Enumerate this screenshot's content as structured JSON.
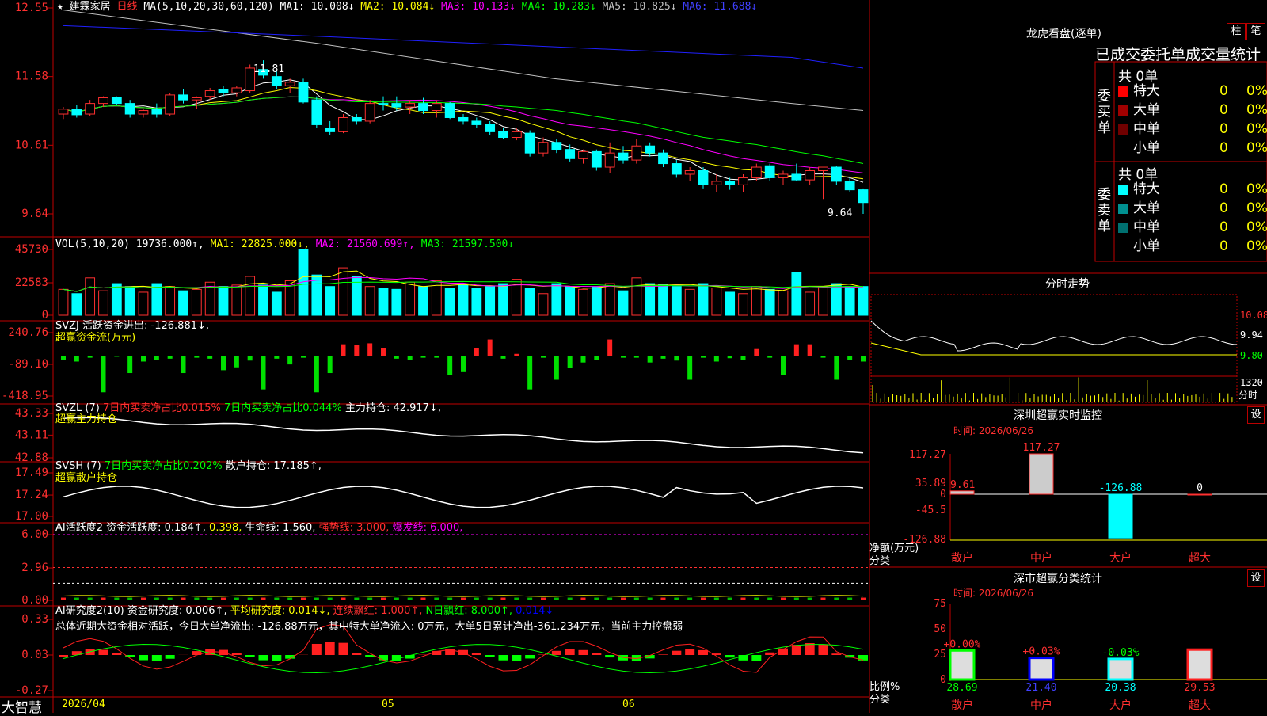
{
  "stock": {
    "name": "建霖家居",
    "period": "日线",
    "star": "★"
  },
  "ma_legend": {
    "prefix": "MA(5,10,20,30,60,120)",
    "items": [
      {
        "label": "MA1: 10.008↓",
        "color": "#ffffff"
      },
      {
        "label": "MA2: 10.084↓",
        "color": "#ffff00"
      },
      {
        "label": "MA3: 10.133↓",
        "color": "#ff00ff"
      },
      {
        "label": "MA4: 10.283↓",
        "color": "#00ff00"
      },
      {
        "label": "MA5: 10.825↓",
        "color": "#c0c0c0"
      },
      {
        "label": "MA6: 11.688↓",
        "color": "#0000ff"
      }
    ]
  },
  "price_axis": [
    "12.55",
    "11.58",
    "10.61",
    "9.64"
  ],
  "price_marks": {
    "high": "11.81",
    "low": "9.64"
  },
  "vol_legend": {
    "prefix": "VOL(5,10,20)",
    "value": "19736.000↑,",
    "items": [
      {
        "label": "MA1: 22825.000↓,",
        "color": "#ffff00"
      },
      {
        "label": "MA2: 21560.699↑,",
        "color": "#ff00ff"
      },
      {
        "label": "MA3: 21597.500↓",
        "color": "#00ff00"
      }
    ]
  },
  "vol_axis": [
    "45730",
    "22583",
    "0"
  ],
  "svzj": {
    "l1": "SVZJ",
    "l2": "活跃资金进出: -126.881↓,",
    "l3": "超赢资金流(万元)",
    "axis": [
      "240.76",
      "-89.10",
      "-418.95"
    ]
  },
  "svzl": {
    "l1": "SVZL (7)",
    "l2": "7日内买卖净占比0.015%",
    "l3": "7日内买卖净占比0.044%",
    "l4": "主力持仓: 42.917↓,",
    "l5": "超赢主力持仓",
    "axis": [
      "43.33",
      "43.11",
      "42.88"
    ]
  },
  "svsh": {
    "l1": "SVSH (7)",
    "l2": "7日内买卖净占比0.202%",
    "l3": "散户持仓: 17.185↑,",
    "l4": "超赢散户持仓",
    "axis": [
      "17.49",
      "17.24",
      "17.00"
    ]
  },
  "ai1": {
    "l1": "AI活跃度2",
    "l2": "资金活跃度: 0.184↑,",
    "l3": "0.398,",
    "l4": "生命线: 1.560,",
    "l5": "强势线: 3.000,",
    "l6": "爆发线: 6.000,",
    "axis": [
      "6.00",
      "2.96",
      "0.00"
    ]
  },
  "ai2": {
    "l1": "AI研究度2(10)",
    "l2": "资金研究度: 0.006↑,",
    "l3": "平均研究度: 0.014↓,",
    "l4": "连续飘红: 1.000↑,",
    "l5": "N日飘红: 8.000↑,",
    "l6": "0.014↓",
    "summary": "总体近期大资金相对活跃，今日大单净流出: -126.88万元，其中特大单净流入: 0万元，大单5日累计净出-361.234万元，当前主力控盘弱",
    "axis": [
      "0.33",
      "0.03",
      "-0.27"
    ]
  },
  "xaxis": {
    "d1": "2026/04",
    "d2": "05",
    "d3": "06",
    "brand": "大智慧"
  },
  "right": {
    "longhu_title": "龙虎看盘(逐单)",
    "btn_zhu": "柱",
    "btn_bi": "笔",
    "stats_header": "已成交委托单成交量统计",
    "buy": {
      "label": "委买单",
      "total": "共 0单",
      "rows": [
        {
          "name": "特大",
          "n": "0",
          "p": "0%",
          "color": "#ff0000"
        },
        {
          "name": "大单",
          "n": "0",
          "p": "0%",
          "color": "#a00000"
        },
        {
          "name": "中单",
          "n": "0",
          "p": "0%",
          "color": "#700000"
        },
        {
          "name": "小单",
          "n": "0",
          "p": "0%",
          "color": "#000000"
        }
      ]
    },
    "sell": {
      "label": "委卖单",
      "total": "共 0单",
      "rows": [
        {
          "name": "特大",
          "n": "0",
          "p": "0%",
          "color": "#00ffff"
        },
        {
          "name": "大单",
          "n": "0",
          "p": "0%",
          "color": "#009090"
        },
        {
          "name": "中单",
          "n": "0",
          "p": "0%",
          "color": "#007070"
        },
        {
          "name": "小单",
          "n": "0",
          "p": "0%",
          "color": "#000000"
        }
      ]
    },
    "fenshi_title": "分时走势",
    "fenshi_axis": [
      "10.08",
      "9.94",
      "9.80",
      "1320",
      "分时"
    ],
    "monitor_title": "深圳超赢实时监控",
    "monitor_btn": "设",
    "monitor_time": "时间: 2026/06/26",
    "monitor_axis": [
      "117.27",
      "35.89",
      "0",
      "-45.5",
      "-126.88"
    ],
    "monitor_labels": [
      "9.61",
      "117.27",
      "-126.88",
      "0"
    ],
    "monitor_ylabel": "净额(万元)",
    "monitor_xlabel": "分类",
    "cats": [
      "散户",
      "中户",
      "大户",
      "超大"
    ],
    "class_title": "深市超赢分类统计",
    "class_btn": "设",
    "class_time": "时间: 2026/06/26",
    "class_axis": [
      "75",
      "50",
      "25",
      "0"
    ],
    "class_pct": [
      "+0.00%",
      "+0.03%",
      "-0.03%",
      ""
    ],
    "class_vals": [
      "28.69",
      "21.40",
      "20.38",
      "29.53"
    ],
    "class_ylabel": "比例%",
    "class_xlabel": "分类"
  },
  "chart_data": {
    "type": "candlestick",
    "title": "建霖家居 日线",
    "dates_span": [
      "2026/04",
      "05",
      "06"
    ],
    "ohlc": [
      [
        11.05,
        11.15,
        10.98,
        11.12
      ],
      [
        11.12,
        11.18,
        11.0,
        11.04
      ],
      [
        11.05,
        11.25,
        11.02,
        11.2
      ],
      [
        11.2,
        11.3,
        11.15,
        11.28
      ],
      [
        11.28,
        11.3,
        11.18,
        11.2
      ],
      [
        11.2,
        11.25,
        11.0,
        11.05
      ],
      [
        11.05,
        11.12,
        11.0,
        11.1
      ],
      [
        11.12,
        11.2,
        11.0,
        11.05
      ],
      [
        11.05,
        11.35,
        11.02,
        11.32
      ],
      [
        11.32,
        11.4,
        11.2,
        11.25
      ],
      [
        11.25,
        11.3,
        11.12,
        11.28
      ],
      [
        11.3,
        11.42,
        11.25,
        11.38
      ],
      [
        11.4,
        11.45,
        11.3,
        11.35
      ],
      [
        11.35,
        11.45,
        11.3,
        11.42
      ],
      [
        11.38,
        11.75,
        11.35,
        11.7
      ],
      [
        11.68,
        11.81,
        11.55,
        11.6
      ],
      [
        11.58,
        11.65,
        11.4,
        11.45
      ],
      [
        11.45,
        11.55,
        11.35,
        11.5
      ],
      [
        11.5,
        11.55,
        11.2,
        11.22
      ],
      [
        11.25,
        11.3,
        10.85,
        10.9
      ],
      [
        10.85,
        10.95,
        10.75,
        10.8
      ],
      [
        10.8,
        11.05,
        10.78,
        11.0
      ],
      [
        11.0,
        11.05,
        10.9,
        10.95
      ],
      [
        10.95,
        11.25,
        10.92,
        11.2
      ],
      [
        11.2,
        11.3,
        11.1,
        11.18
      ],
      [
        11.2,
        11.3,
        11.1,
        11.15
      ],
      [
        11.15,
        11.25,
        11.05,
        11.2
      ],
      [
        11.2,
        11.28,
        11.05,
        11.1
      ],
      [
        11.1,
        11.25,
        11.0,
        11.2
      ],
      [
        11.2,
        11.22,
        10.98,
        11.0
      ],
      [
        11.0,
        11.05,
        10.9,
        10.95
      ],
      [
        10.95,
        11.0,
        10.85,
        10.9
      ],
      [
        10.9,
        10.95,
        10.75,
        10.8
      ],
      [
        10.8,
        10.85,
        10.7,
        10.72
      ],
      [
        10.72,
        10.85,
        10.68,
        10.8
      ],
      [
        10.78,
        10.82,
        10.45,
        10.5
      ],
      [
        10.5,
        10.72,
        10.45,
        10.65
      ],
      [
        10.65,
        10.7,
        10.5,
        10.55
      ],
      [
        10.55,
        10.62,
        10.38,
        10.42
      ],
      [
        10.42,
        10.55,
        10.35,
        10.52
      ],
      [
        10.52,
        10.55,
        10.25,
        10.3
      ],
      [
        10.3,
        10.65,
        10.22,
        10.5
      ],
      [
        10.5,
        10.6,
        10.35,
        10.4
      ],
      [
        10.4,
        10.7,
        10.35,
        10.6
      ],
      [
        10.6,
        10.65,
        10.45,
        10.5
      ],
      [
        10.5,
        10.55,
        10.3,
        10.35
      ],
      [
        10.35,
        10.4,
        10.15,
        10.2
      ],
      [
        10.2,
        10.3,
        10.1,
        10.25
      ],
      [
        10.25,
        10.3,
        10.0,
        10.05
      ],
      [
        10.05,
        10.2,
        9.95,
        10.1
      ],
      [
        10.1,
        10.15,
        9.98,
        10.05
      ],
      [
        10.05,
        10.2,
        9.95,
        10.15
      ],
      [
        10.15,
        10.35,
        10.1,
        10.3
      ],
      [
        10.32,
        10.35,
        10.1,
        10.15
      ],
      [
        10.15,
        10.25,
        10.05,
        10.2
      ],
      [
        10.2,
        10.35,
        10.1,
        10.12
      ],
      [
        10.12,
        10.3,
        10.05,
        10.25
      ],
      [
        10.25,
        10.3,
        9.85,
        10.3
      ],
      [
        10.3,
        10.32,
        10.05,
        10.1
      ],
      [
        10.1,
        10.15,
        9.95,
        9.98
      ],
      [
        9.98,
        10.0,
        9.64,
        9.8
      ]
    ]
  }
}
